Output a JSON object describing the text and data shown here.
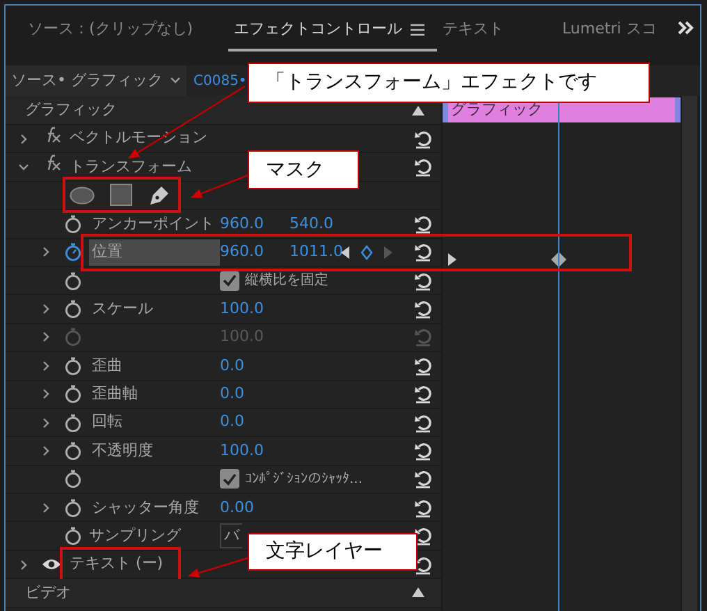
{
  "tabs": [
    {
      "label": "ソース：(クリップなし)",
      "selected": false
    },
    {
      "label": "エフェクトコントロール",
      "selected": true
    },
    {
      "label": "テキスト",
      "selected": false
    },
    {
      "label": "Lumetri スコ",
      "selected": false
    }
  ],
  "source_bar": {
    "source": "ソース• グラフィック",
    "clip": "C0085•"
  },
  "section_header": "グラフィック",
  "timeline": {
    "clip": "グラフィック"
  },
  "rows": [
    {
      "kind": "effect",
      "label": "ベクトルモーション",
      "expanded": false
    },
    {
      "kind": "effect",
      "label": "トランスフォーム",
      "expanded": true
    },
    {
      "kind": "mask_tools",
      "highlighted": true
    },
    {
      "kind": "property",
      "label": "アンカーポイント",
      "values": [
        "960.0",
        "540.0"
      ],
      "expandable": false,
      "animated": false
    },
    {
      "kind": "property",
      "label": "位置",
      "values": [
        "960.0",
        "1011.0"
      ],
      "expandable": true,
      "animated": true,
      "selected": true,
      "highlighted": true
    },
    {
      "kind": "checkbox",
      "label": "縦横比を固定",
      "checked": true
    },
    {
      "kind": "property",
      "label": "スケール",
      "values": [
        "100.0"
      ],
      "expandable": true,
      "animated": false
    },
    {
      "kind": "property",
      "values": [
        "100.0"
      ],
      "expandable": true,
      "animated": false,
      "disabled": true
    },
    {
      "kind": "property",
      "label": "歪曲",
      "values": [
        "0.0"
      ],
      "expandable": true,
      "animated": false
    },
    {
      "kind": "property",
      "label": "歪曲軸",
      "values": [
        "0.0"
      ],
      "expandable": true,
      "animated": false
    },
    {
      "kind": "property",
      "label": "回転",
      "values": [
        "0.0"
      ],
      "expandable": true,
      "animated": false
    },
    {
      "kind": "property",
      "label": "不透明度",
      "values": [
        "100.0"
      ],
      "expandable": true,
      "animated": false
    },
    {
      "kind": "checkbox",
      "label": "ｺﾝﾎﾟｼﾞｼｮﾝのｼｬｯﾀ...",
      "checked": true
    },
    {
      "kind": "property",
      "label": "シャッター角度",
      "values": [
        "0.00"
      ],
      "expandable": true,
      "animated": false
    },
    {
      "kind": "dropdown",
      "label": "サンプリング",
      "value": "バ"
    },
    {
      "kind": "layer",
      "label": "テキスト (ー)",
      "expanded": false,
      "highlighted": true
    },
    {
      "kind": "section",
      "label": "ビデオ"
    }
  ],
  "callouts": [
    {
      "text": "「トランスフォーム」エフェクトです"
    },
    {
      "text": "マスク"
    },
    {
      "text": "文字レイヤー"
    }
  ]
}
